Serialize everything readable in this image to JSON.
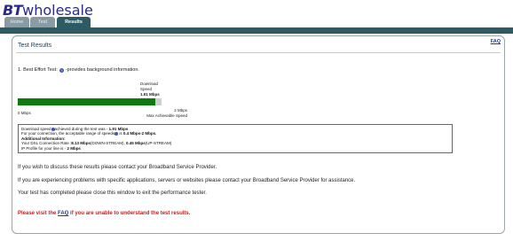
{
  "header": {
    "logo_bt": "BT",
    "logo_rest": "wholesale",
    "tabs": [
      {
        "label": "Home"
      },
      {
        "label": "Test"
      },
      {
        "label": "Results"
      }
    ]
  },
  "panel": {
    "faq_link": "FAQ",
    "title": "Test Results",
    "intro_prefix": "1. Best Effort Test:",
    "intro_suffix": "-provides background information.",
    "download_label": "Download",
    "speed_label": "Speed",
    "download_value": "1.91 Mbps",
    "download_fraction": 0.955,
    "axis_min": "0 Mbps",
    "axis_max_value": "2 Mbps",
    "axis_max_label": "Max Achievable Speed",
    "info": {
      "line1_pre": "Download speed",
      "line1_mid": "achieved during the test was - ",
      "line1_val": "1.91 Mbps",
      "line2_pre": "For your connection, the acceptable range of speeds",
      "line2_mid": " is ",
      "line2_val": "0.4 Mbps-2 Mbps.",
      "line3": "Additional Information:",
      "line4_pre": "Your DSL Connection Rate :",
      "line4_v1": "8.13 Mbps",
      "line4_mid": "(DOWN-STREAM), ",
      "line4_v2": "0.45 Mbps",
      "line4_post": "(UP-STREAM)",
      "line5_pre": "IP Profile for your line is - ",
      "line5_val": "2 Mbps"
    },
    "para1": "If you wish to discuss these results please contact your Broadband Service Provider.",
    "para2": "If you are experiencing problems with specific applications, servers or websites please contact your Broadband Service Provider for assistance.",
    "para3": "Your test has completed please close this window to exit the performance tester.",
    "red_pre": "Please visit the ",
    "red_link": "FAQ",
    "red_post": " if you are unable to understand the test results."
  }
}
